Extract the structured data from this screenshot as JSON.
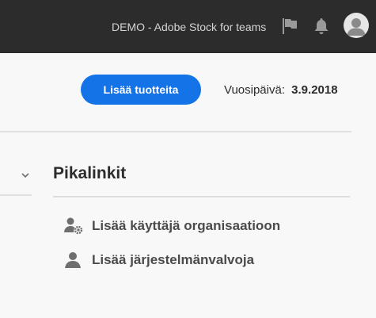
{
  "header": {
    "org_name": "DEMO - Adobe Stock for teams",
    "icons": [
      "flag-icon",
      "bell-icon",
      "avatar-icon"
    ]
  },
  "actions": {
    "add_products_label": "Lisää tuotteita",
    "anniversary_label": "Vuosipäivä:",
    "anniversary_date": "3.9.2018"
  },
  "quicklinks": {
    "title": "Pikalinkit",
    "items": [
      {
        "label": "Lisää käyttäjä organisaatioon",
        "icon": "user-gear-icon"
      },
      {
        "label": "Lisää järjestelmänvalvoja",
        "icon": "user-icon"
      }
    ]
  },
  "colors": {
    "topbar": "#2c2c2c",
    "accent": "#1473e6",
    "background": "#f8f8f8"
  }
}
